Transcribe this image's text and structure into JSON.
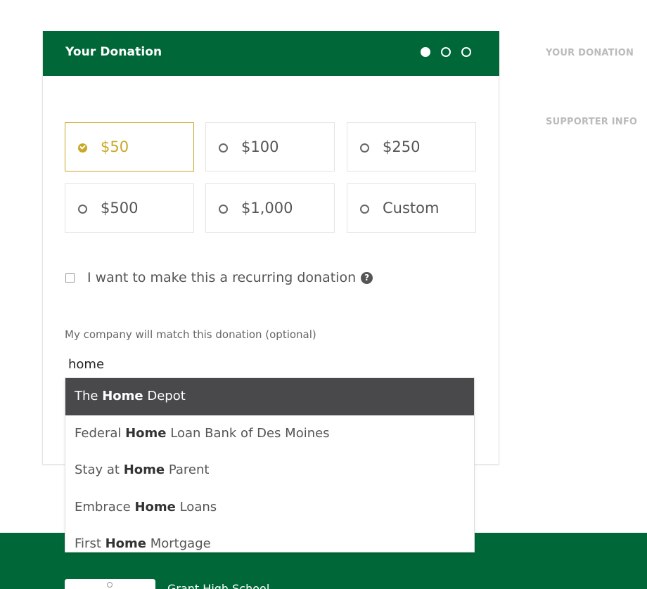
{
  "card": {
    "title": "Your Donation",
    "step_count": 3,
    "active_step": 1
  },
  "amounts": [
    {
      "label": "$50",
      "selected": true
    },
    {
      "label": "$100",
      "selected": false
    },
    {
      "label": "$250",
      "selected": false
    },
    {
      "label": "$500",
      "selected": false
    },
    {
      "label": "$1,000",
      "selected": false
    },
    {
      "label": "Custom",
      "selected": false
    }
  ],
  "recurring": {
    "label": "I want to make this a recurring donation",
    "checked": false,
    "help_icon": "question-circle-icon"
  },
  "company_match": {
    "label": "My company will match this donation (optional)",
    "value": "home",
    "suggestions": [
      {
        "before": "The ",
        "match": "Home",
        "after": " Depot"
      },
      {
        "before": "Federal ",
        "match": "Home",
        "after": " Loan Bank of Des Moines"
      },
      {
        "before": "Stay at ",
        "match": "Home",
        "after": " Parent"
      },
      {
        "before": "Embrace ",
        "match": "Home",
        "after": " Loans"
      },
      {
        "before": "First ",
        "match": "Home",
        "after": " Mortgage"
      }
    ],
    "highlighted_index": 0
  },
  "sidebar": {
    "steps": [
      "YOUR DONATION",
      "SUPPORTER INFO"
    ]
  },
  "footer": {
    "org_name": "Grant High School"
  },
  "colors": {
    "brand_green": "#006838",
    "selected_gold": "#c9a826",
    "highlight_dark": "#49494c"
  }
}
